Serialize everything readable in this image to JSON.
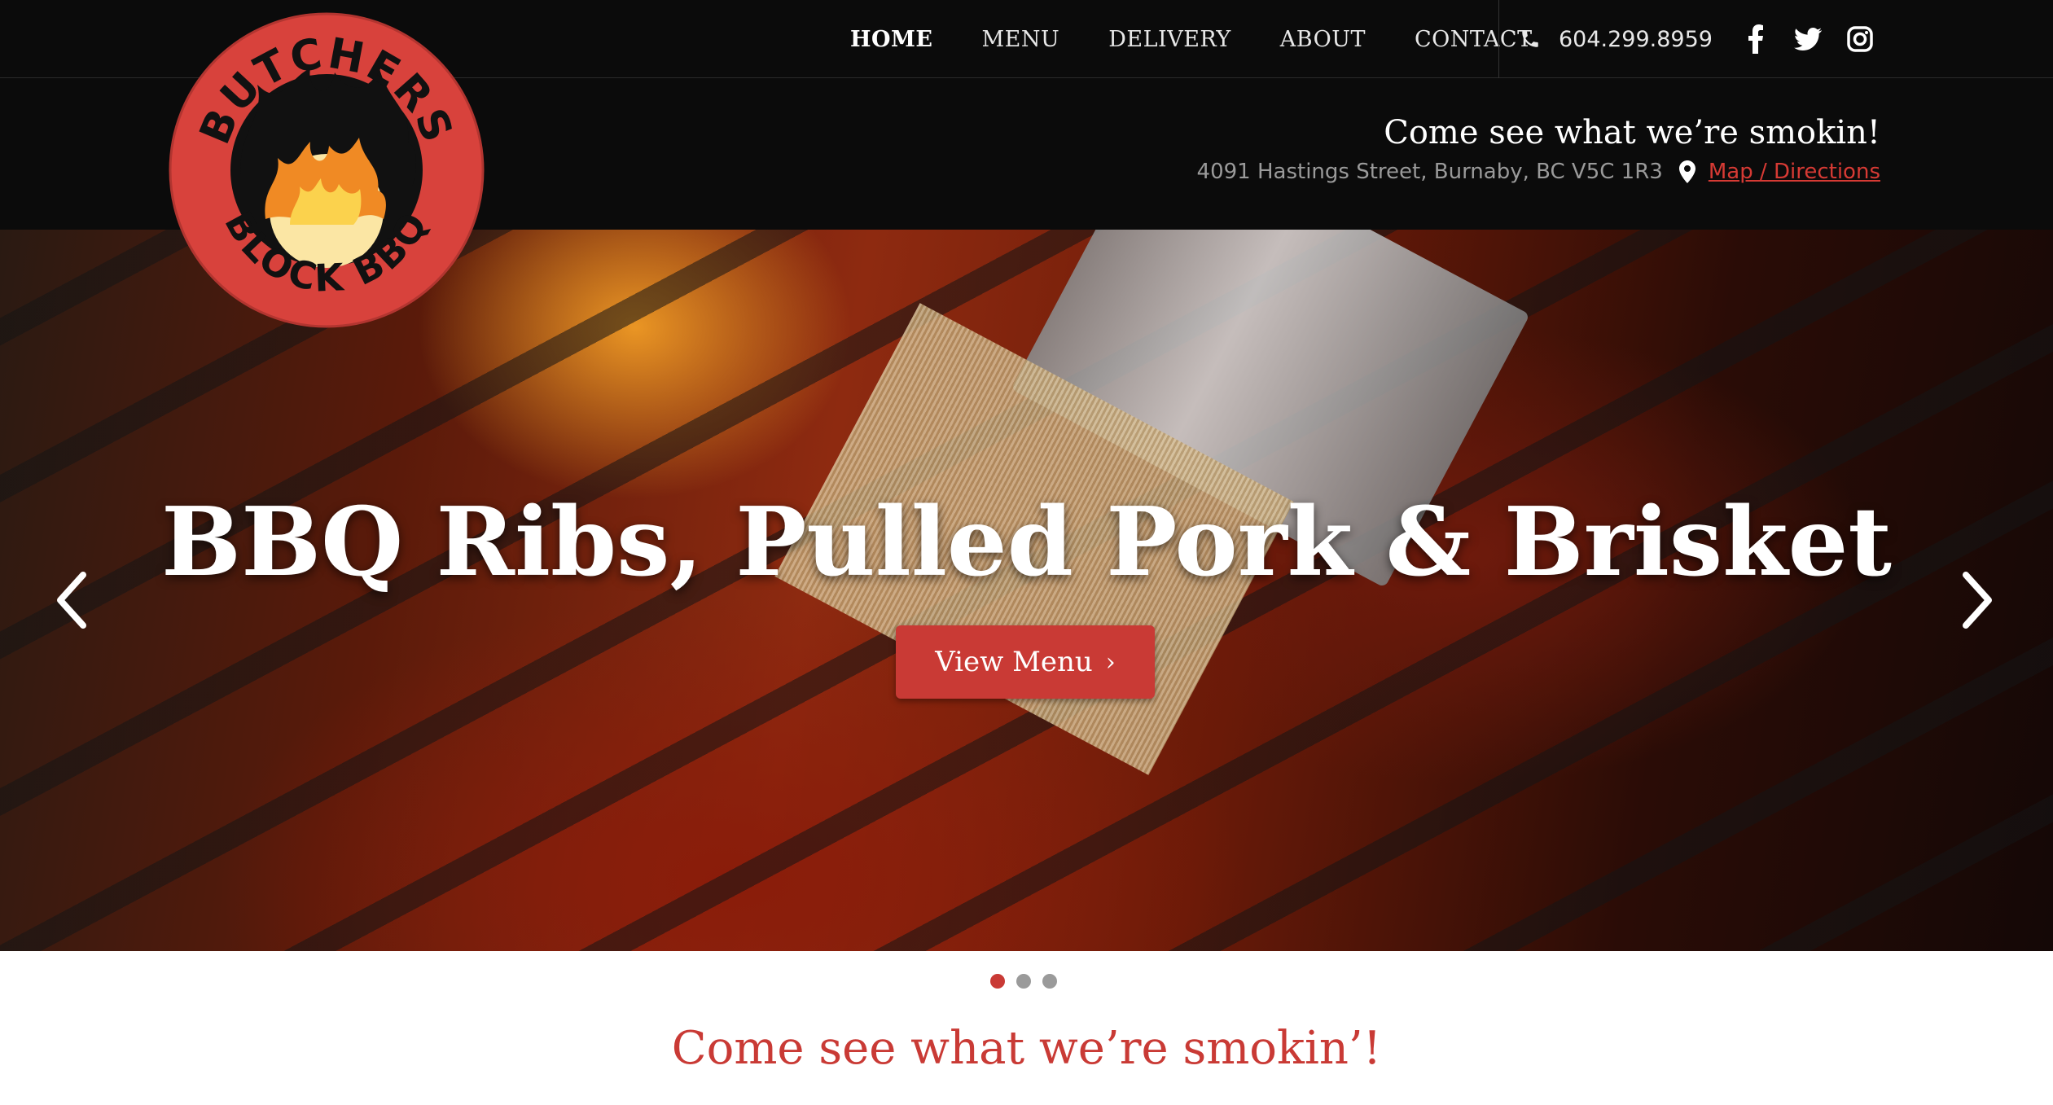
{
  "nav": {
    "items": [
      {
        "label": "HOME",
        "active": true
      },
      {
        "label": "MENU",
        "active": false
      },
      {
        "label": "DELIVERY",
        "active": false
      },
      {
        "label": "ABOUT",
        "active": false
      },
      {
        "label": "CONTACT",
        "active": false
      }
    ]
  },
  "contact": {
    "phone": "604.299.8959",
    "icons": [
      "phone-icon",
      "facebook-icon",
      "twitter-icon",
      "instagram-icon"
    ]
  },
  "header": {
    "tagline": "Come see what we’re smokin!",
    "address": "4091 Hastings Street, Burnaby, BC V5C 1R3",
    "map_link": "Map / Directions"
  },
  "logo": {
    "top_text": "BUTCHERS",
    "bottom_text": "BLOCK BBQ"
  },
  "hero": {
    "title": "BBQ Ribs, Pulled Pork & Brisket",
    "button_label": "View Menu",
    "slide_count": 3,
    "active_slide": 1
  },
  "section": {
    "heading": "Come see what we’re smokin’!"
  },
  "colors": {
    "brand_red": "#c93a35",
    "header_bg": "#0b0b0b",
    "link_red": "#d63a34"
  }
}
